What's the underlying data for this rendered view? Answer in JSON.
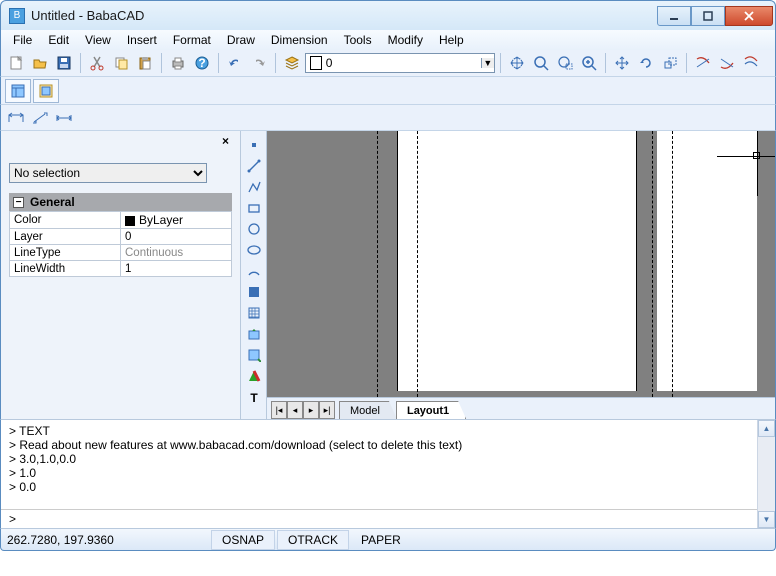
{
  "window": {
    "title": "Untitled - BabaCAD"
  },
  "menu": [
    "File",
    "Edit",
    "View",
    "Insert",
    "Format",
    "Draw",
    "Dimension",
    "Tools",
    "Modify",
    "Help"
  ],
  "layer": {
    "value": "0"
  },
  "properties": {
    "selector": "No selection",
    "group": "General",
    "rows": [
      {
        "k": "Color",
        "v": "ByLayer",
        "swatch": true
      },
      {
        "k": "Layer",
        "v": "0"
      },
      {
        "k": "LineType",
        "v": "Continuous",
        "gray": true
      },
      {
        "k": "LineWidth",
        "v": "1"
      }
    ]
  },
  "tabs": {
    "model": "Model",
    "layout1": "Layout1"
  },
  "command": {
    "lines": [
      "> TEXT",
      "> Read about new features at www.babacad.com/download (select to delete this text)",
      "> 3.0,1.0,0.0",
      "> 1.0",
      "> 0.0"
    ],
    "prompt": ">"
  },
  "status": {
    "coords": "262.7280, 197.9360",
    "osnap": "OSNAP",
    "otrack": "OTRACK",
    "paper": "PAPER"
  }
}
